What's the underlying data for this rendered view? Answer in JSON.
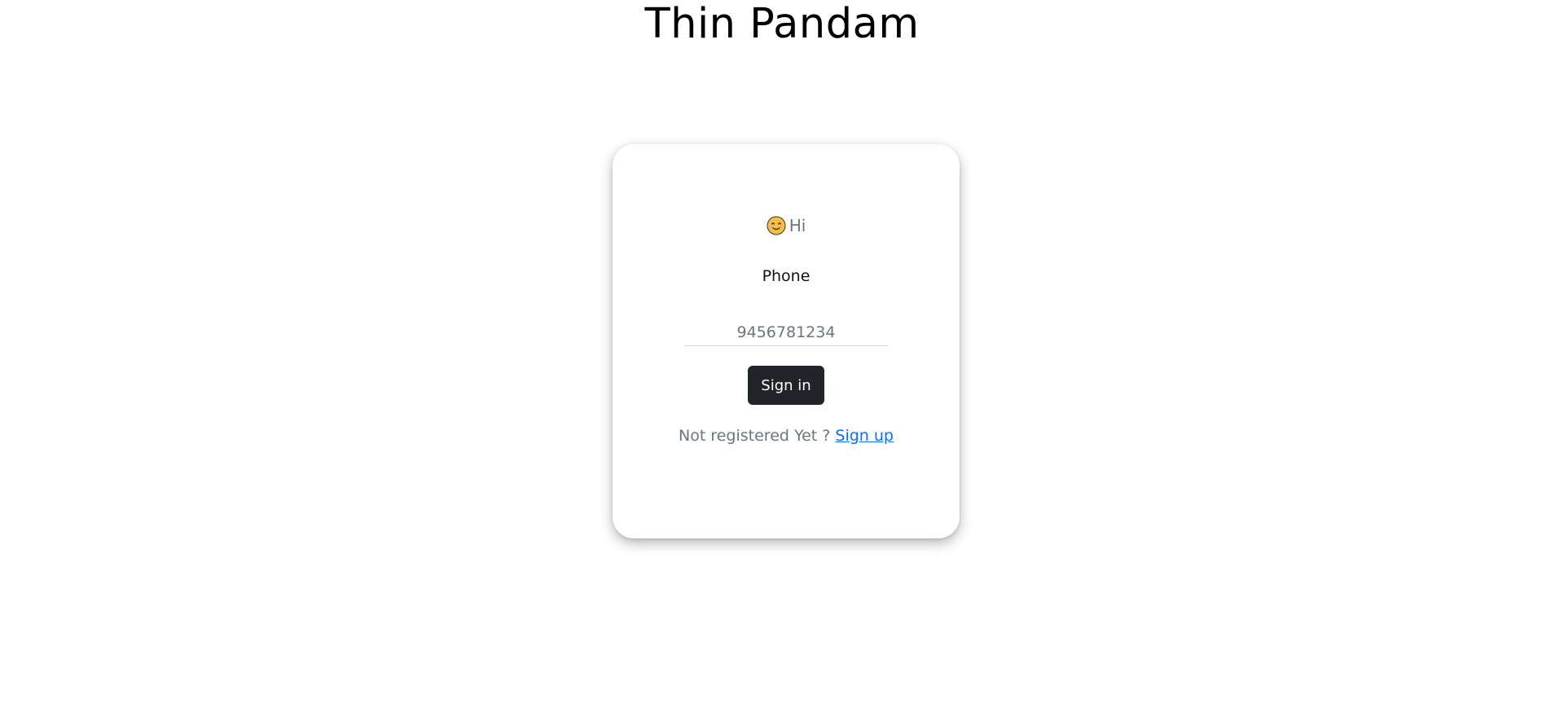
{
  "app": {
    "title": "Thin Pandam"
  },
  "login_card": {
    "greeting_icon": "smiling-face-icon",
    "greeting_text": "Hi",
    "phone_label": "Phone",
    "phone_input": {
      "value": "",
      "placeholder": "9456781234"
    },
    "signin_label": "Sign in",
    "register_prompt": "Not registered Yet ?",
    "signup_link": "Sign up"
  },
  "colors": {
    "button_bg": "#212529",
    "link": "#0d6efd",
    "muted_text": "#6c757d"
  }
}
